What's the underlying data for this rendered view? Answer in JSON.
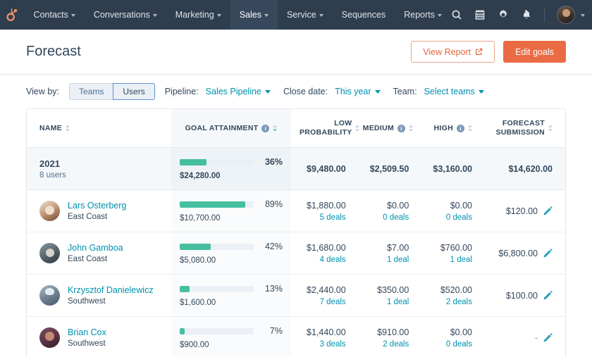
{
  "nav": {
    "logo": "hubspot-logo",
    "items": [
      {
        "label": "Contacts",
        "caret": true,
        "active": false
      },
      {
        "label": "Conversations",
        "caret": true,
        "active": false
      },
      {
        "label": "Marketing",
        "caret": true,
        "active": false
      },
      {
        "label": "Sales",
        "caret": true,
        "active": true
      },
      {
        "label": "Service",
        "caret": true,
        "active": false
      },
      {
        "label": "Sequences",
        "caret": false,
        "active": false
      },
      {
        "label": "Reports",
        "caret": true,
        "active": false
      }
    ],
    "icons": [
      "search-icon",
      "marketplace-icon",
      "settings-gear-icon",
      "notifications-bell-icon"
    ],
    "avatar": "user-avatar"
  },
  "header": {
    "title": "Forecast",
    "view_report_label": "View Report",
    "edit_goals_label": "Edit goals"
  },
  "filters": {
    "view_by_label": "View by:",
    "toggle": {
      "teams": "Teams",
      "users": "Users",
      "selected": "Users"
    },
    "pipeline_label": "Pipeline:",
    "pipeline_value": "Sales Pipeline",
    "close_date_label": "Close date:",
    "close_date_value": "This year",
    "team_label": "Team:",
    "team_value": "Select teams"
  },
  "table": {
    "headers": {
      "name": "NAME",
      "goal_attainment": "GOAL ATTAINMENT",
      "low_probability_line1": "LOW",
      "low_probability_line2": "PROBABILITY",
      "medium": "MEDIUM",
      "high": "HIGH",
      "forecast_line1": "FORECAST",
      "forecast_line2": "SUBMISSION"
    },
    "summary": {
      "title": "2021",
      "subtitle": "8 users",
      "goal_pct": "36%",
      "goal_pct_value": 36,
      "goal_amount": "$24,280.00",
      "low": "$9,480.00",
      "medium": "$2,509.50",
      "high": "$3,160.00",
      "forecast": "$14,620.00"
    },
    "rows": [
      {
        "name": "Lars Osterberg",
        "team": "East Coast",
        "avatar": "avatar-lars-osterberg",
        "goal_pct": "89%",
        "goal_pct_value": 89,
        "goal_amount": "$10,700.00",
        "low": "$1,880.00",
        "low_deals": "5 deals",
        "medium": "$0.00",
        "medium_deals": "0 deals",
        "high": "$0.00",
        "high_deals": "0 deals",
        "forecast": "$120.00"
      },
      {
        "name": "John Gamboa",
        "team": "East Coast",
        "avatar": "avatar-john-gamboa",
        "goal_pct": "42%",
        "goal_pct_value": 42,
        "goal_amount": "$5,080.00",
        "low": "$1,680.00",
        "low_deals": "4 deals",
        "medium": "$7.00",
        "medium_deals": "1 deal",
        "high": "$760.00",
        "high_deals": "1 deal",
        "forecast": "$6,800.00"
      },
      {
        "name": "Krzysztof Danielewicz",
        "team": "Southwest",
        "avatar": "avatar-krzysztof-danielewicz",
        "goal_pct": "13%",
        "goal_pct_value": 13,
        "goal_amount": "$1,600.00",
        "low": "$2,440.00",
        "low_deals": "7 deals",
        "medium": "$350.00",
        "medium_deals": "1 deal",
        "high": "$520.00",
        "high_deals": "2 deals",
        "forecast": "$100.00"
      },
      {
        "name": "Brian Cox",
        "team": "Southwest",
        "avatar": "avatar-brian-cox",
        "goal_pct": "7%",
        "goal_pct_value": 7,
        "goal_amount": "$900.00",
        "low": "$1,440.00",
        "low_deals": "3 deals",
        "medium": "$910.00",
        "medium_deals": "2 deals",
        "high": "$0.00",
        "high_deals": "0 deals",
        "forecast": "-"
      }
    ]
  },
  "colors": {
    "nav_bg": "#2e3e4e",
    "accent_orange": "#ea6b43",
    "link_teal": "#0091ae",
    "progress_green": "#45bfa0",
    "text_dark": "#33475b"
  }
}
